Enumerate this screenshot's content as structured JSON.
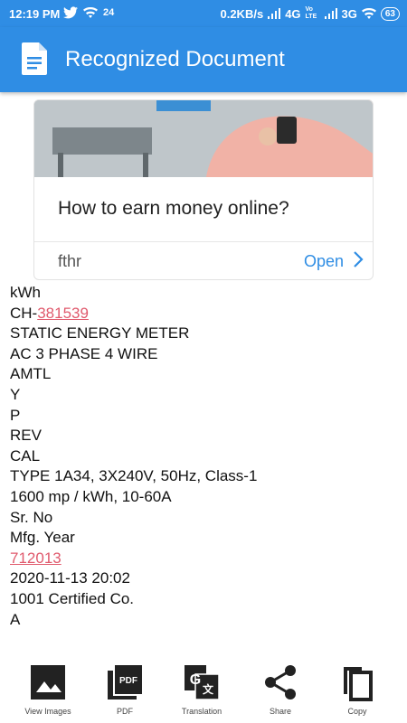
{
  "status_bar": {
    "time": "12:19 PM",
    "notification_count": "24",
    "network_speed": "0.2KB/s",
    "net1": "4G",
    "volte": "Vo LTE",
    "net2": "3G",
    "battery": "63"
  },
  "toolbar": {
    "title": "Recognized Document",
    "icon": "document-icon"
  },
  "ad": {
    "headline": "How to earn money online?",
    "advertiser": "fthr",
    "cta_label": "Open"
  },
  "document": {
    "lines": [
      {
        "text": "kWh"
      },
      {
        "prefix": "CH-",
        "link": "381539"
      },
      {
        "text": "STATIC ENERGY METER"
      },
      {
        "text": "AC 3 PHASE 4 WIRE"
      },
      {
        "text": "AMTL"
      },
      {
        "text": "Y"
      },
      {
        "text": "P"
      },
      {
        "text": "REV"
      },
      {
        "text": "CAL"
      },
      {
        "text": "TYPE 1A34, 3X240V, 50Hz, Class-1"
      },
      {
        "text": "1600 mp / kWh, 10-60A"
      },
      {
        "text": "Sr. No"
      },
      {
        "text": "Mfg. Year"
      },
      {
        "link": "712013"
      },
      {
        "text": "2020-11-13 20:02"
      },
      {
        "text": "1001 Certified Co."
      },
      {
        "text": "A"
      }
    ]
  },
  "bottom_bar": {
    "items": [
      {
        "label": "View Images",
        "icon": "image-icon"
      },
      {
        "label": "PDF",
        "icon": "pdf-icon"
      },
      {
        "label": "Translation",
        "icon": "translate-icon"
      },
      {
        "label": "Share",
        "icon": "share-icon"
      },
      {
        "label": "Copy",
        "icon": "copy-icon"
      }
    ]
  }
}
